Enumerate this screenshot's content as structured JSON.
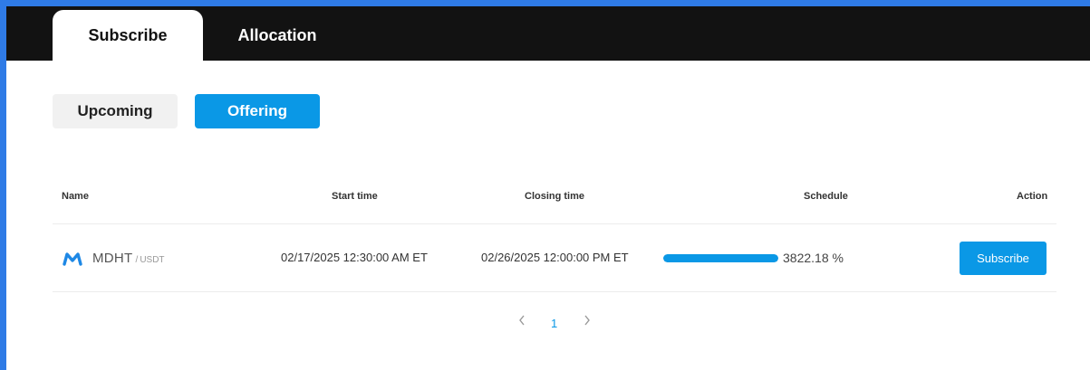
{
  "main_tabs": [
    {
      "label": "Subscribe",
      "active": true
    },
    {
      "label": "Allocation",
      "active": false
    }
  ],
  "sub_tabs": [
    {
      "label": "Upcoming",
      "active": false
    },
    {
      "label": "Offering",
      "active": true
    }
  ],
  "table": {
    "headers": {
      "name": "Name",
      "start": "Start time",
      "closing": "Closing time",
      "schedule": "Schedule",
      "action": "Action"
    },
    "rows": [
      {
        "icon": "mdht-logo-icon",
        "symbol": "MDHT",
        "separator": "/",
        "quote": "USDT",
        "start_time": "02/17/2025 12:30:00 AM ET",
        "closing_time": "02/26/2025 12:00:00 PM ET",
        "progress_fraction": 1.0,
        "schedule_text": "3822.18 %",
        "action_label": "Subscribe"
      }
    ]
  },
  "pagination": {
    "prev_icon": "chevron-left-icon",
    "current": "1",
    "next_icon": "chevron-right-icon"
  },
  "colors": {
    "accent": "#0a98e6",
    "topbar": "#121212",
    "outer": "#2f7be6"
  }
}
